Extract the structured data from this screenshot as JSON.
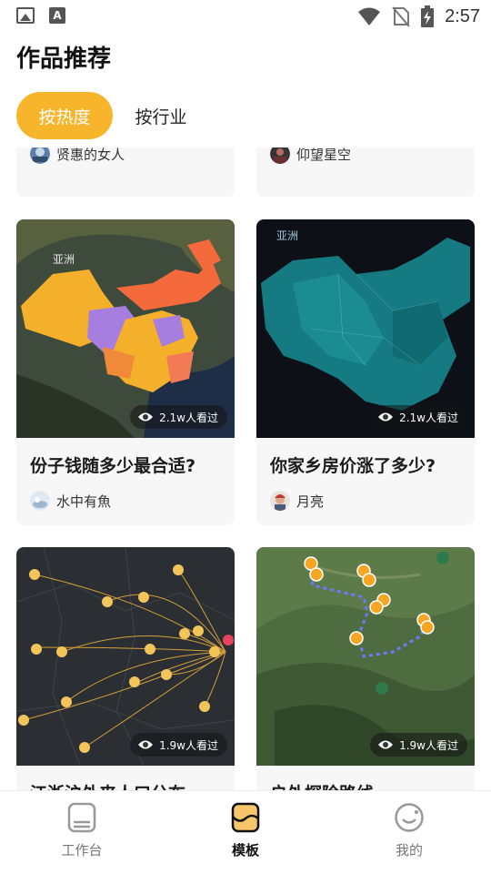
{
  "status_bar": {
    "time": "2:57",
    "icons": [
      "image-icon",
      "a-icon",
      "wifi-icon",
      "no-sim-icon",
      "battery-charging-icon"
    ]
  },
  "header": {
    "title": "作品推荐"
  },
  "tabs": [
    {
      "label": "按热度",
      "active": true
    },
    {
      "label": "按行业",
      "active": false
    }
  ],
  "feed": {
    "top_partial": [
      {
        "author": "贤惠的女人"
      },
      {
        "author": "仰望星空"
      }
    ],
    "cards": [
      {
        "title": "份子钱随多少最合适?",
        "views": "2.1w人看过",
        "author": "水中有魚",
        "map_label": "亚洲"
      },
      {
        "title": "你家乡房价涨了多少?",
        "views": "2.1w人看过",
        "author": "月亮",
        "map_label": "亚洲"
      },
      {
        "title": "江浙沪外来人口分布",
        "views": "1.9w人看过",
        "author": ""
      },
      {
        "title": "户外探险路线",
        "views": "1.9w人看过",
        "author": ""
      }
    ]
  },
  "bottom_nav": [
    {
      "label": "工作台",
      "icon": "workbench-icon",
      "active": false
    },
    {
      "label": "模板",
      "icon": "template-icon",
      "active": true
    },
    {
      "label": "我的",
      "icon": "profile-icon",
      "active": false
    }
  ],
  "colors": {
    "accent": "#f7b52c",
    "text": "#1b1b1b",
    "card_bg": "#f7f7f8"
  }
}
